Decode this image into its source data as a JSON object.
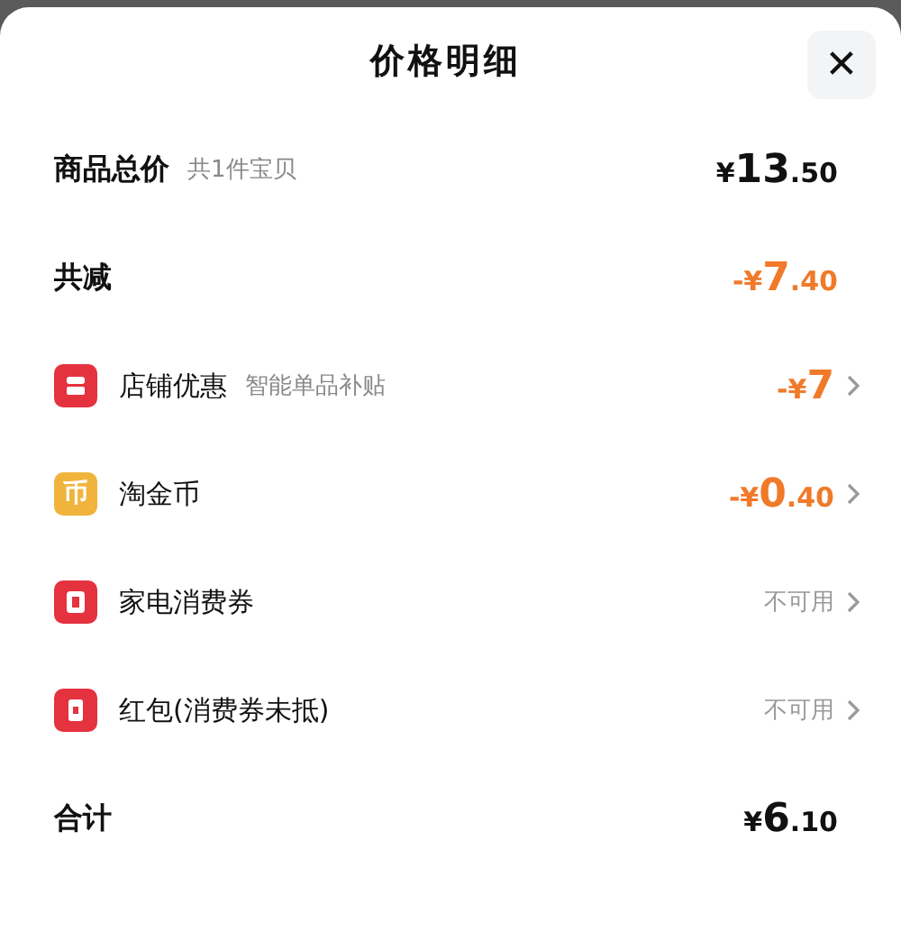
{
  "title": "价格明细",
  "close": {
    "glyph": "✕"
  },
  "rows": [
    {
      "kind": "summary",
      "label": "商品总价",
      "note": "共1件宝贝",
      "amount": {
        "sign": "¥",
        "whole": "13",
        "fraction": ".50"
      },
      "highlight": false
    },
    {
      "kind": "summary",
      "label": "共减",
      "amount": {
        "sign": "-¥",
        "whole": "7",
        "fraction": ".40"
      },
      "highlight": true
    },
    {
      "kind": "discount",
      "color": "#e5323f",
      "label": "店铺优惠",
      "note": "智能单品补贴",
      "amount": {
        "sign": "-¥",
        "whole": "7"
      },
      "highlight": true
    },
    {
      "kind": "discount",
      "icon_glyph": "币",
      "color": "#f0b43c",
      "label": "淘金币",
      "amount": {
        "sign": "-¥",
        "whole": "0",
        "fraction": ".40"
      },
      "highlight": true
    },
    {
      "kind": "discount",
      "color": "#e5323f",
      "label": "家电消费券",
      "status": "不可用"
    },
    {
      "kind": "discount",
      "color": "#e5323f",
      "label": "红包(消费券未抵)",
      "status": "不可用"
    },
    {
      "kind": "summary",
      "label": "合计",
      "amount": {
        "sign": "¥",
        "whole": "6",
        "fraction": ".10"
      },
      "highlight": false
    }
  ]
}
